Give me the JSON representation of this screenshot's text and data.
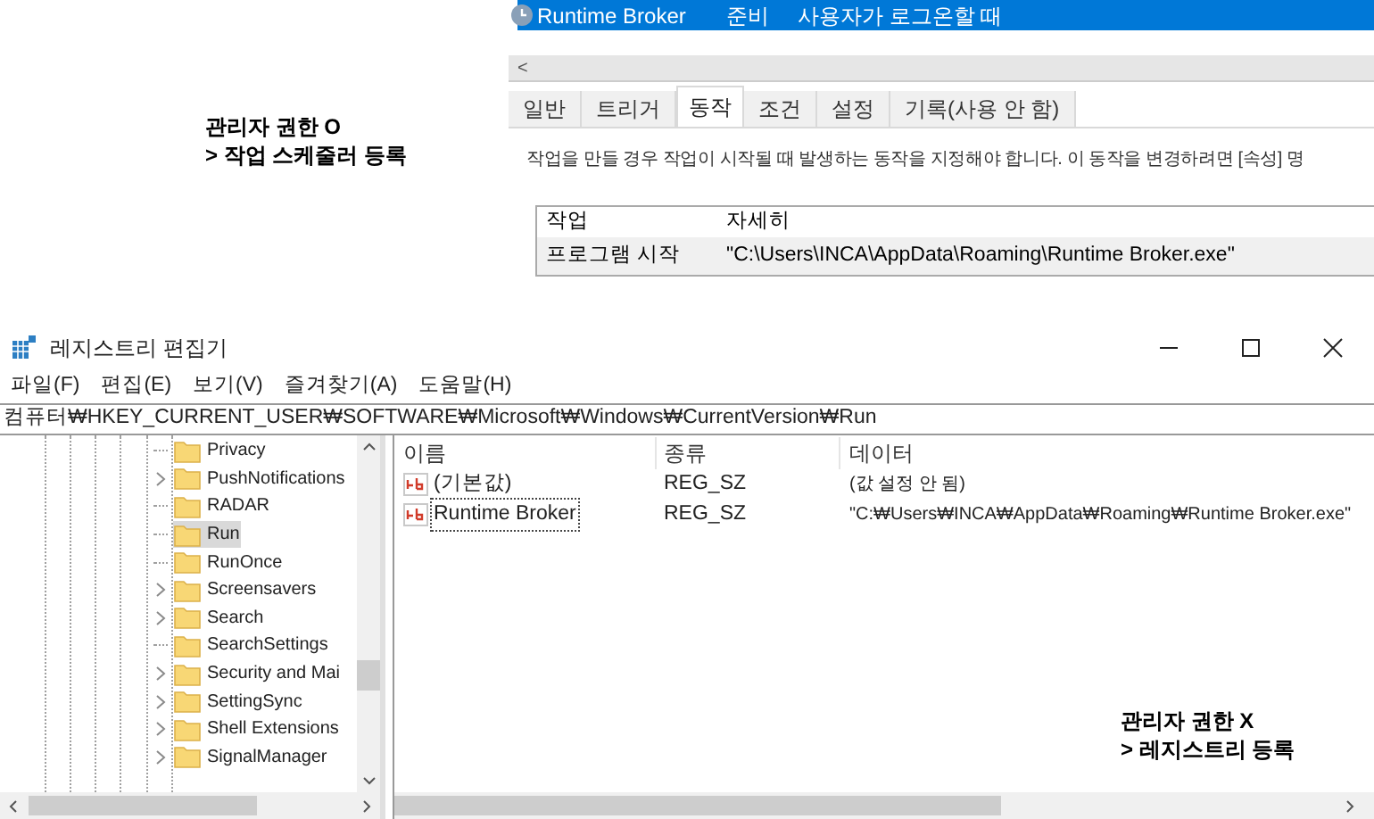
{
  "scheduler": {
    "task": {
      "name": "Runtime Broker",
      "status": "준비",
      "trigger": "사용자가 로그온할 때"
    },
    "scroll_left": "<",
    "tabs": [
      {
        "label": "일반",
        "selected": false
      },
      {
        "label": "트리거",
        "selected": false
      },
      {
        "label": "동작",
        "selected": true
      },
      {
        "label": "조건",
        "selected": false
      },
      {
        "label": "설정",
        "selected": false
      },
      {
        "label": "기록(사용 안 함)",
        "selected": false
      }
    ],
    "description": "작업을 만들 경우 작업이 시작될 때 발생하는 동작을 지정해야 합니다. 이 동작을 변경하려면 [속성] 명",
    "table": {
      "columns": [
        "작업",
        "자세히"
      ],
      "rows": [
        [
          "프로그램 시작",
          "\"C:\\Users\\INCA\\AppData\\Roaming\\Runtime Broker.exe\""
        ]
      ]
    }
  },
  "annotation_admin": {
    "line1": "관리자 권한 O",
    "line2": "> 작업 스케줄러 등록"
  },
  "registry": {
    "title": "레지스트리 편집기",
    "menu": [
      "파일(F)",
      "편집(E)",
      "보기(V)",
      "즐겨찾기(A)",
      "도움말(H)"
    ],
    "address": "컴퓨터₩HKEY_CURRENT_USER₩SOFTWARE₩Microsoft₩Windows₩CurrentVersion₩Run",
    "tree": [
      {
        "label": "Privacy",
        "kind": "leaf",
        "selected": false
      },
      {
        "label": "PushNotifications",
        "kind": "branch",
        "selected": false
      },
      {
        "label": "RADAR",
        "kind": "leaf",
        "selected": false
      },
      {
        "label": "Run",
        "kind": "leaf",
        "selected": true
      },
      {
        "label": "RunOnce",
        "kind": "leaf",
        "selected": false
      },
      {
        "label": "Screensavers",
        "kind": "branch",
        "selected": false
      },
      {
        "label": "Search",
        "kind": "branch",
        "selected": false
      },
      {
        "label": "SearchSettings",
        "kind": "leaf",
        "selected": false
      },
      {
        "label": "Security and Mai",
        "kind": "branch",
        "selected": false
      },
      {
        "label": "SettingSync",
        "kind": "branch",
        "selected": false
      },
      {
        "label": "Shell Extensions",
        "kind": "branch",
        "selected": false
      },
      {
        "label": "SignalManager",
        "kind": "branch",
        "selected": false
      }
    ],
    "columns": [
      "이름",
      "종류",
      "데이터"
    ],
    "values": [
      {
        "name": "(기본값)",
        "type": "REG_SZ",
        "data": "(값 설정 안 됨)",
        "focused": false
      },
      {
        "name": "Runtime Broker",
        "type": "REG_SZ",
        "data": "\"C:₩Users₩INCA₩AppData₩Roaming₩Runtime Broker.exe\"",
        "focused": true
      }
    ]
  },
  "annotation_user": {
    "line1": "관리자 권한 X",
    "line2": "> 레지스트리 등록"
  }
}
